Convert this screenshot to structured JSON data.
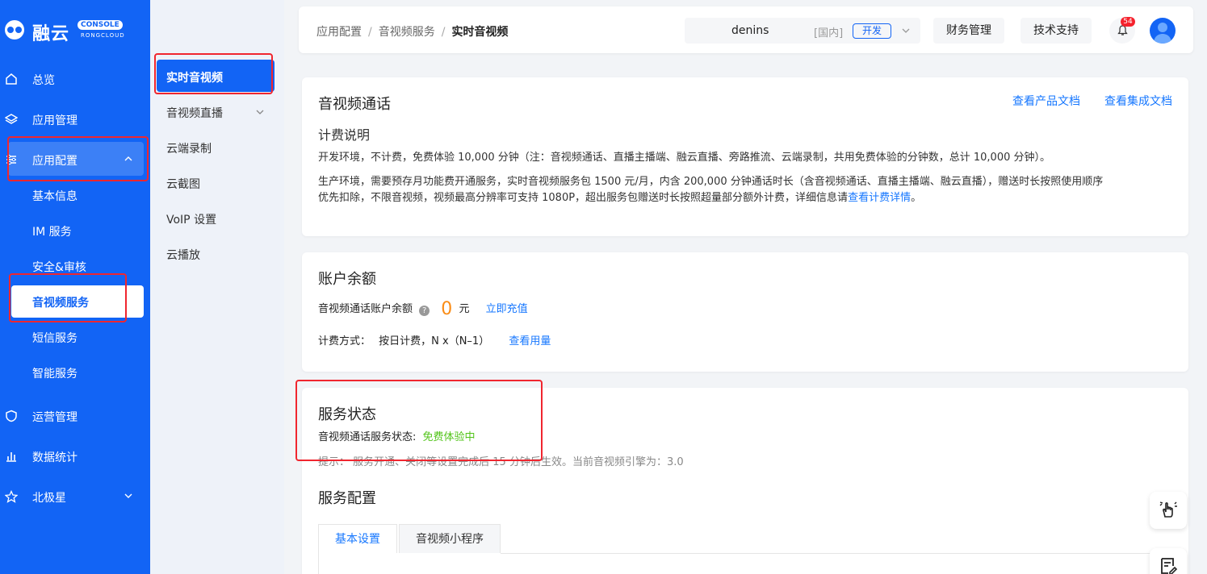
{
  "brand": {
    "name": "融云",
    "console_badge": "CONSOLE",
    "sub": "RONGCLOUD"
  },
  "sidebar": {
    "items": [
      {
        "label": "总览",
        "icon": "home-icon"
      },
      {
        "label": "应用管理",
        "icon": "layers-icon"
      },
      {
        "label": "应用配置",
        "icon": "config-icon"
      },
      {
        "label": "运营管理",
        "icon": "shield-icon"
      },
      {
        "label": "数据统计",
        "icon": "bar-chart-icon"
      },
      {
        "label": "北极星",
        "icon": "star-icon"
      }
    ],
    "sub_items": [
      "基本信息",
      "IM 服务",
      "安全&审核",
      "音视频服务",
      "短信服务",
      "智能服务"
    ]
  },
  "subnav": {
    "items": [
      "实时音视频",
      "音视频直播",
      "云端录制",
      "云截图",
      "VoIP 设置",
      "云播放"
    ]
  },
  "header": {
    "breadcrumb": [
      "应用配置",
      "音视频服务",
      "实时音视频"
    ],
    "account_name": "denins",
    "region": "[国内]",
    "env": "开发",
    "finance": "财务管理",
    "support": "技术支持",
    "notifications": "54"
  },
  "call_card": {
    "title": "音视频通话",
    "doc_link": "查看产品文档",
    "integration_link": "查看集成文档",
    "billing_title": "计费说明",
    "line1": "开发环境，不计费，免费体验 10,000 分钟（注：音视频通话、直播主播端、融云直播、旁路推流、云端录制，共用免费体验的分钟数，总计 10,000 分钟）。",
    "line2": "生产环境，需要预存月功能费开通服务，实时音视频服务包 1500 元/月，内含 200,000 分钟通话时长（含音视频通话、直播主播端、融云直播），赠送时长按照使用顺序",
    "line3_pre": "优先扣除，不限音视频，视频最高分辨率可支持 1080P，超出服务包赠送时长按照超量部分额外计费，详细信息请",
    "line3_link": "查看计费详情",
    "line3_post": "。"
  },
  "balance_card": {
    "title": "账户余额",
    "balance_label": "音视频通话账户余额",
    "balance_value": "0",
    "currency": "元",
    "recharge": "立即充值",
    "billing_label": "计费方式：",
    "billing_value": "按日计费，N x（N–1）",
    "usage_link": "查看用量"
  },
  "status_card": {
    "title": "服务状态",
    "status_label": "音视频通话服务状态:",
    "status_value": "免费体验中",
    "tip": "提示：  服务开通、关闭等设置完成后 15 分钟后生效。当前音视频引擎为：3.0",
    "config_title": "服务配置",
    "tabs": [
      "基本设置",
      "音视频小程序"
    ]
  },
  "colors": {
    "primary": "#1264f5",
    "link": "#1677ff",
    "success": "#52c41a",
    "warning": "#fa8c16",
    "highlight": "#f0262f"
  }
}
